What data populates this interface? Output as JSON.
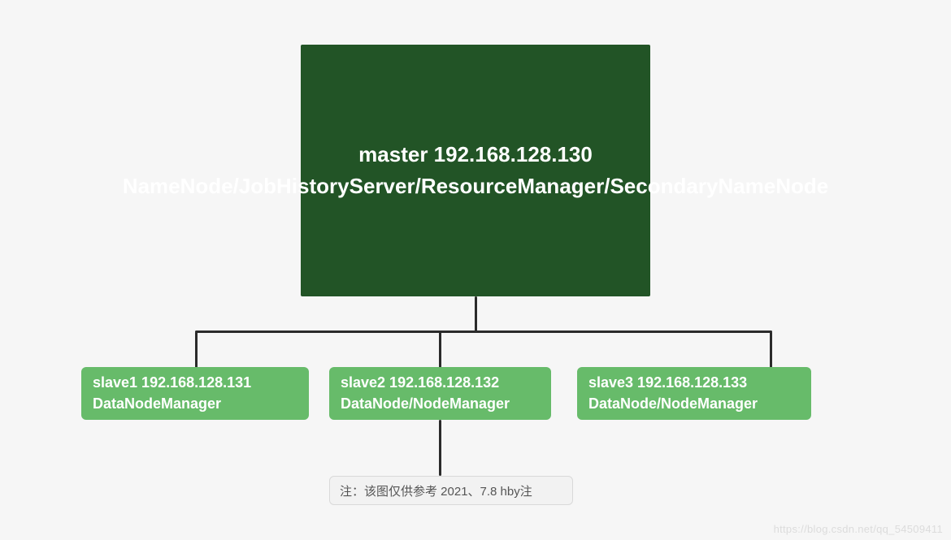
{
  "chart_data": {
    "type": "tree",
    "root": {
      "id": "master",
      "host": "master",
      "ip": "192.168.128.130",
      "services": [
        "NameNode",
        "JobHistoryServer",
        "ResourceManager",
        "SecondaryNameNode"
      ],
      "label": "master    192.168.128.130      NameNode/JobHistoryServer/ResourceManager/SecondaryNameNode",
      "color": "#225426",
      "children": [
        {
          "id": "slave1",
          "host": "slave1",
          "ip": "192.168.128.131",
          "services": [
            "DataNodeManager"
          ],
          "label": "slave1   192.168.128.131   DataNodeManager",
          "color": "#67bb6a"
        },
        {
          "id": "slave2",
          "host": "slave2",
          "ip": "192.168.128.132",
          "services": [
            "DataNode",
            "NodeManager"
          ],
          "label": "slave2   192.168.128.132   DataNode/NodeManager",
          "color": "#67bb6a",
          "children": [
            {
              "id": "note",
              "label": "注：该图仅供参考   2021、7.8    hby注",
              "color": "#f2f2f2"
            }
          ]
        },
        {
          "id": "slave3",
          "host": "slave3",
          "ip": "192.168.128.133",
          "services": [
            "DataNode",
            "NodeManager"
          ],
          "label": "slave3   192.168.128.133   DataNode/NodeManager",
          "color": "#67bb6a"
        }
      ]
    }
  },
  "nodes": {
    "master": "master    192.168.128.130      NameNode/JobHistoryServer/ResourceManager/SecondaryNameNode",
    "slave1": "slave1   192.168.128.131   DataNodeManager",
    "slave2": "slave2   192.168.128.132   DataNode/NodeManager",
    "slave3": "slave3   192.168.128.133   DataNode/NodeManager",
    "note": "注：该图仅供参考   2021、7.8    hby注"
  },
  "watermark": "https://blog.csdn.net/qq_54509411"
}
